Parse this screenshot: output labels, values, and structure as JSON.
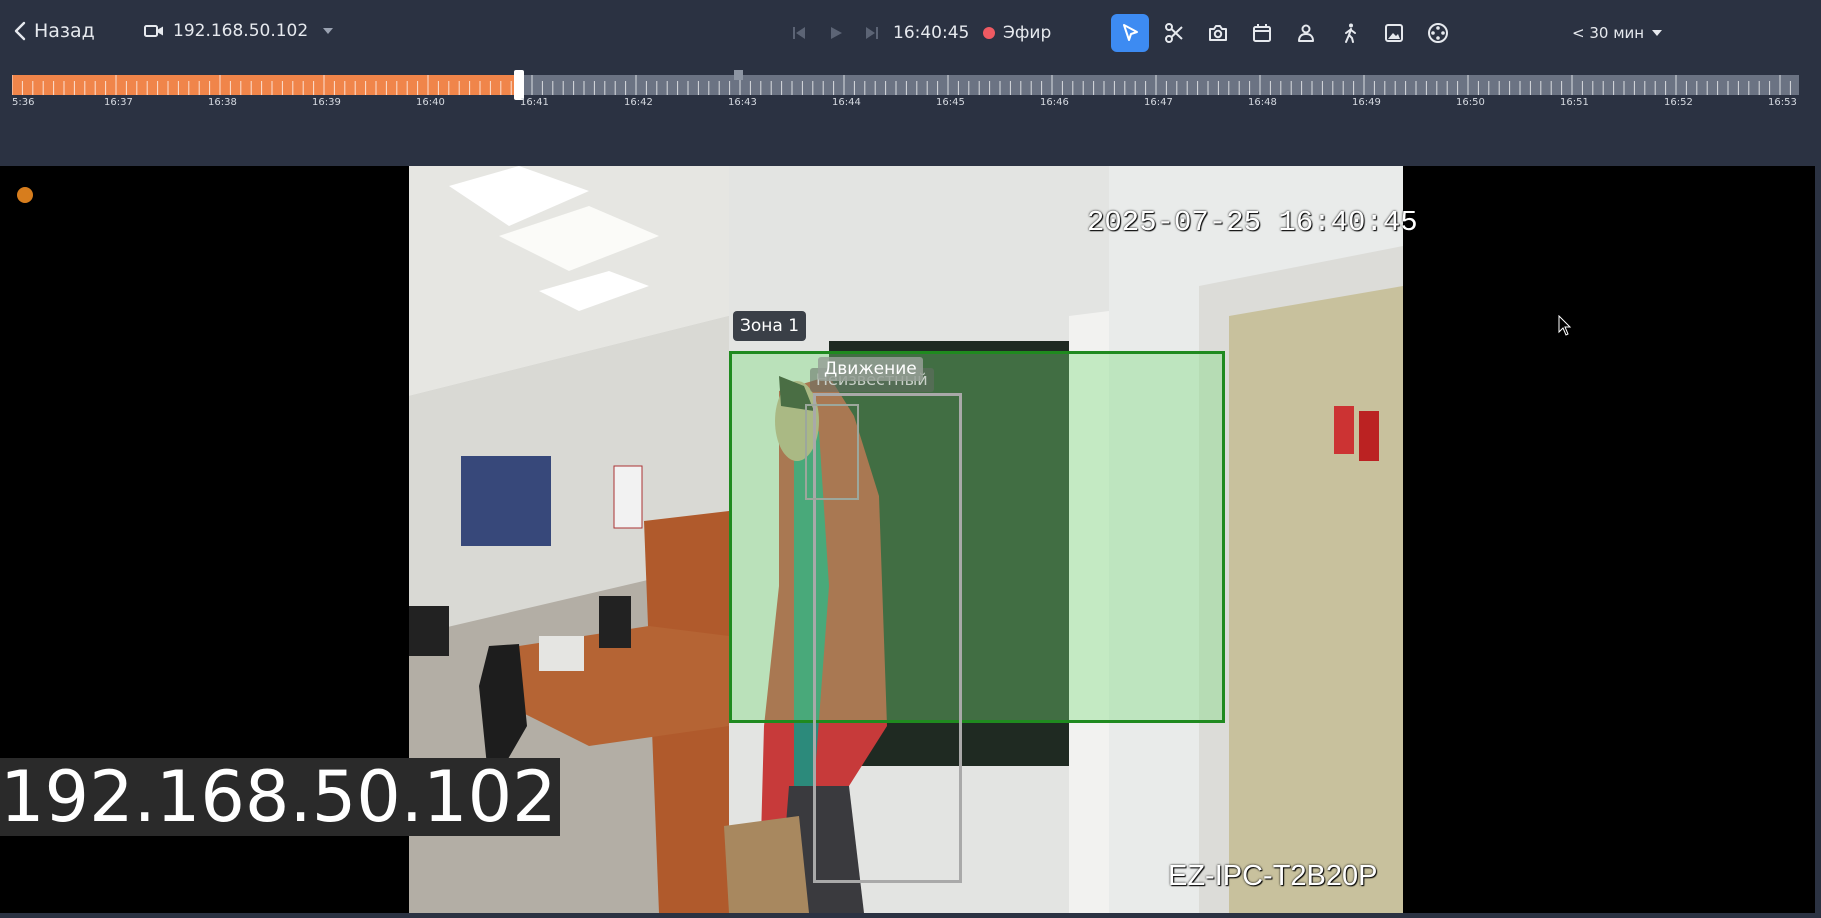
{
  "header": {
    "back_label": "Назад",
    "camera_address": "192.168.50.102",
    "current_time": "16:40:45",
    "live_label": "Эфир",
    "range_label": "< 30 мин"
  },
  "colors": {
    "background": "#2b3242",
    "accent": "#3d8bf2",
    "timeline_played": "#f0854a",
    "timeline_rest": "#6b7383",
    "live_dot": "#ef5a62",
    "zone_border": "#1f8a1f",
    "recording_dot": "#d77d1d"
  },
  "toolbar": {
    "tools": [
      {
        "name": "select-tool",
        "icon": "cursor-arrow-icon",
        "active": true
      },
      {
        "name": "clip-tool",
        "icon": "scissors-icon",
        "active": false
      },
      {
        "name": "snapshot-tool",
        "icon": "camera-icon",
        "active": false
      },
      {
        "name": "calendar-tool",
        "icon": "calendar-icon",
        "active": false
      },
      {
        "name": "face-tool",
        "icon": "person-icon",
        "active": false
      },
      {
        "name": "motion-tool",
        "icon": "walking-person-icon",
        "active": false
      },
      {
        "name": "image-tool",
        "icon": "image-icon",
        "active": false
      },
      {
        "name": "ptz-tool",
        "icon": "joystick-icon",
        "active": false
      }
    ]
  },
  "timeline": {
    "labels": [
      "5:36",
      "16:37",
      "16:38",
      "16:39",
      "16:40",
      "16:41",
      "16:42",
      "16:43",
      "16:44",
      "16:45",
      "16:46",
      "16:47",
      "16:48",
      "16:49",
      "16:50",
      "16:51",
      "16:52",
      "16:53"
    ],
    "played_fraction": 0.282
  },
  "video": {
    "osd_datetime": "2025-07-25 16:40:45",
    "osd_model": "EZ-IPC-T2B20P",
    "zone_label": "Зона 1",
    "motion_label": "Движение",
    "person_label": "Неизвестный",
    "camera_name_overlay": "192.168.50.102"
  }
}
